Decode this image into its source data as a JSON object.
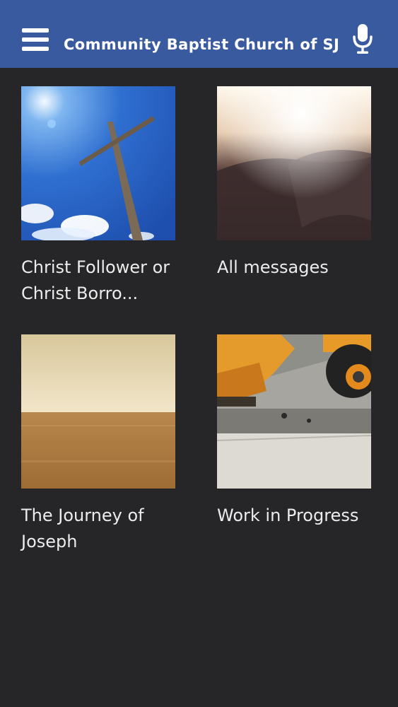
{
  "header": {
    "title": "Community Baptist Church of SJ",
    "menu_icon": "hamburger-menu-icon",
    "mic_icon": "microphone-icon",
    "background": "#3a5aa0"
  },
  "grid": {
    "items": [
      {
        "title": "Christ Follower or Christ Borro...",
        "image": "wooden cross against blue sky"
      },
      {
        "title": "All messages",
        "image": "open book pages in warm light"
      },
      {
        "title": "The Journey of Joseph",
        "image": "desert horizon"
      },
      {
        "title": "Work in Progress",
        "image": "construction vehicle and concrete"
      }
    ]
  },
  "colors": {
    "background": "#262527",
    "caption_text": "#ececec"
  }
}
